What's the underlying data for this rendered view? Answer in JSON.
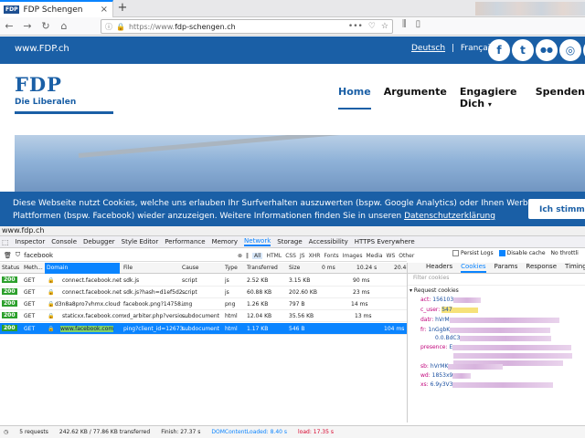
{
  "browser": {
    "tab_title": "FDP Schengen",
    "tab_favicon": "FDP",
    "url_scheme": "https://www.",
    "url_host": "fdp-schengen.ch",
    "new_tab": "+",
    "close": "×"
  },
  "site": {
    "top_logo": "www.FDP.ch",
    "lang_de": "Deutsch",
    "lang_sep": "|",
    "lang_fr": "Français",
    "social": [
      "f",
      "t",
      "●●",
      "◎",
      "in"
    ],
    "logo_big": "FDP",
    "logo_small": "Die Liberalen",
    "menu": [
      "Home",
      "Argumente",
      "Engagiere Dich",
      "Spenden"
    ],
    "menu_dropdown": "▾",
    "cookie_line1": "Diese Webseite nutzt Cookies, welche uns erlauben Ihr Surfverhalten auszuwerten (bspw. Google Analytics) oder Ihnen Werbung auf anderen",
    "cookie_line2": "Plattformen (bspw. Facebook) wieder anzuzeigen. Weitere Informationen finden Sie in unseren ",
    "cookie_link": "Datenschutzerklärung",
    "cookie_button": "Ich stimme zu"
  },
  "devtools": {
    "page_url": "www.fdp.ch",
    "tools": [
      "Inspector",
      "Console",
      "Debugger",
      "Style Editor",
      "Performance",
      "Memory",
      "Network",
      "Storage",
      "Accessibility",
      "HTTPS Everywhere"
    ],
    "active_tool": "Network",
    "filter_value": "facebook",
    "types": [
      "All",
      "HTML",
      "CSS",
      "JS",
      "XHR",
      "Fonts",
      "Images",
      "Media",
      "WS",
      "Other"
    ],
    "persist_logs": "Persist Logs",
    "disable_cache": "Disable cache",
    "throttle": "No throttli",
    "columns": [
      "Status",
      "Meth...",
      "Domain",
      "File",
      "Cause",
      "Type",
      "Transferred",
      "Size",
      "0 ms",
      "10.24 s",
      "20.48"
    ],
    "rows": [
      {
        "status": "200",
        "method": "GET",
        "domain": "connect.facebook.net",
        "file": "sdk.js",
        "cause": "script",
        "type": "js",
        "transferred": "2.52 KB",
        "size": "3.15 KB",
        "time": "90 ms"
      },
      {
        "status": "200",
        "method": "GET",
        "domain": "connect.facebook.net",
        "file": "sdk.js?hash=d1ef5d2...",
        "cause": "script",
        "type": "js",
        "transferred": "60.88 KB",
        "size": "202.60 KB",
        "time": "23 ms"
      },
      {
        "status": "200",
        "method": "GET",
        "domain": "d3n8a8pro7vhmx.cloudfront.net",
        "file": "facebook.png?14758...",
        "cause": "img",
        "type": "png",
        "transferred": "1.26 KB",
        "size": "797 B",
        "time": "14 ms"
      },
      {
        "status": "200",
        "method": "GET",
        "domain": "staticxx.facebook.com",
        "file": "xd_arbiter.php?versio...",
        "cause": "subdocument",
        "type": "html",
        "transferred": "12.04 KB",
        "size": "35.56 KB",
        "time": "13 ms"
      },
      {
        "status": "200",
        "method": "GET",
        "domain": "www.facebook.com",
        "file": "ping?client_id=12673...",
        "cause": "subdocument",
        "type": "html",
        "transferred": "1.17 KB",
        "size": "546 B",
        "time": "104 ms"
      }
    ],
    "panel_tabs": [
      "Headers",
      "Cookies",
      "Params",
      "Response",
      "Timings"
    ],
    "active_panel": "Cookies",
    "panel_filter": "Filter cookies",
    "request_cookies": "▾ Request cookies",
    "cookies": [
      {
        "k": "act:",
        "v": "156103"
      },
      {
        "k": "c_user:",
        "v": "547"
      },
      {
        "k": "datr:",
        "v": "hVrM"
      },
      {
        "k": "fr:",
        "v": "1nGgbK"
      },
      {
        "k": "",
        "v": "0.0.BdC3"
      },
      {
        "k": "presence:",
        "v": "E"
      },
      {
        "k": "sb:",
        "v": "hVrMK"
      },
      {
        "k": "wd:",
        "v": "1853x9"
      },
      {
        "k": "xs:",
        "v": "6.9y3V3"
      }
    ],
    "status": {
      "requests": "5 requests",
      "transferred": "242.62 KB / 77.86 KB transferred",
      "finish": "Finish: 27.37 s",
      "dcl": "DOMContentLoaded: 8.40 s",
      "load": "load: 17.35 s"
    }
  }
}
